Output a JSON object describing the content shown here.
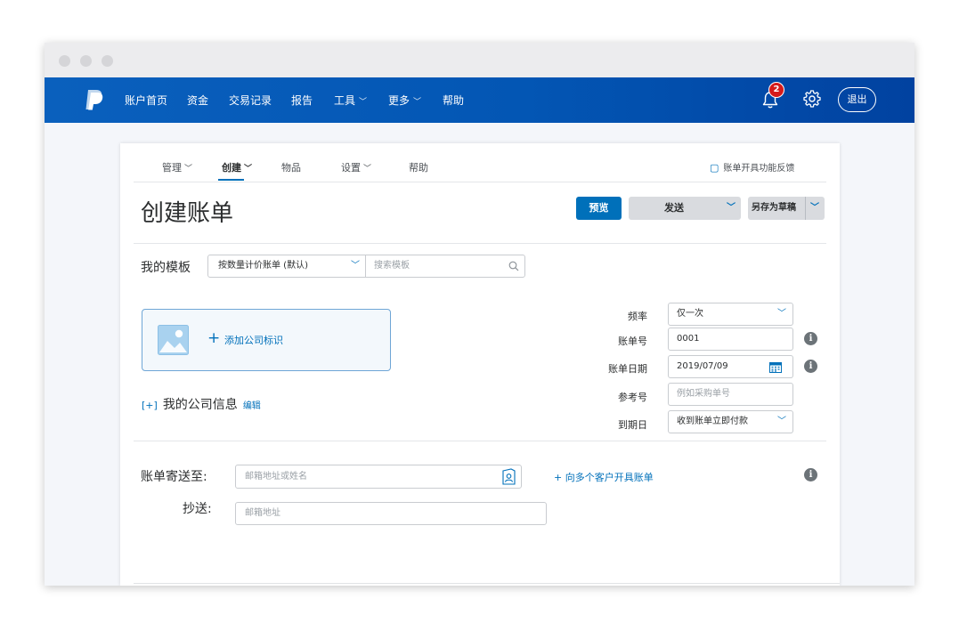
{
  "nav": {
    "items": [
      {
        "label": "账户首页"
      },
      {
        "label": "资金"
      },
      {
        "label": "交易记录"
      },
      {
        "label": "报告"
      },
      {
        "label": "工具",
        "chevron": true
      },
      {
        "label": "更多",
        "chevron": true
      },
      {
        "label": "帮助"
      }
    ],
    "notification_count": "2",
    "logout": "退出"
  },
  "subnav": {
    "items": [
      {
        "label": "管理",
        "chevron": true
      },
      {
        "label": "创建",
        "chevron": true,
        "active": true
      },
      {
        "label": "物品"
      },
      {
        "label": "设置",
        "chevron": true
      },
      {
        "label": "帮助"
      }
    ],
    "feedback": "账单开具功能反馈"
  },
  "page": {
    "title": "创建账单",
    "preview": "预览",
    "send": "发送",
    "save_draft": "另存为草稿"
  },
  "template": {
    "label": "我的模板",
    "selected": "按数量计价账单 (默认)",
    "search_placeholder": "搜索模板"
  },
  "company": {
    "add_logo": "添加公司标识",
    "expand": "[+]",
    "info_label": "我的公司信息",
    "edit": "编辑"
  },
  "invoice_fields": {
    "frequency": {
      "label": "频率",
      "value": "仅一次"
    },
    "number": {
      "label": "账单号",
      "value": "0001"
    },
    "date": {
      "label": "账单日期",
      "value": "2019/07/09"
    },
    "reference": {
      "label": "参考号",
      "placeholder": "例如采购单号"
    },
    "due": {
      "label": "到期日",
      "value": "收到账单立即付款"
    }
  },
  "recipients": {
    "to_label": "账单寄送至:",
    "to_placeholder": "邮箱地址或姓名",
    "multi_link": "+ 向多个客户开具账单",
    "cc_label": "抄送:",
    "cc_placeholder": "邮箱地址"
  },
  "colors": {
    "brand_blue": "#0070ba",
    "nav_blue": "#0356b4",
    "badge_red": "#d51a1a"
  }
}
